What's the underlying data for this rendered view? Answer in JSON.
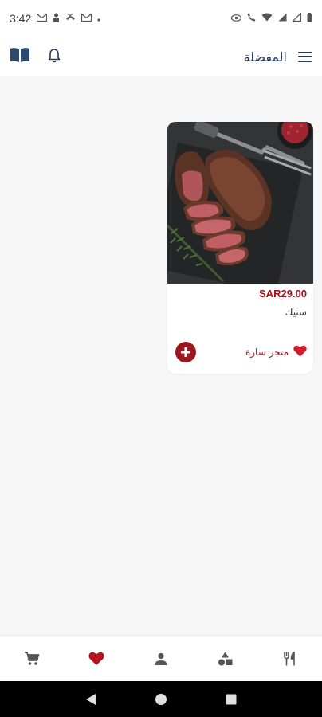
{
  "status_bar": {
    "time": "3:42",
    "icons_left": [
      "gmail-icon",
      "person-icon",
      "missed-call-icon",
      "gmail-icon",
      "dot-icon"
    ],
    "icons_right": [
      "eye-icon",
      "call-icon",
      "wifi-icon",
      "signal-icon",
      "signal-icon",
      "battery-icon"
    ]
  },
  "header": {
    "title": "المفضلة",
    "menu_icon": "hamburger-menu-icon",
    "book_icon": "book-icon",
    "bell_icon": "bell-icon"
  },
  "favorites": [
    {
      "price": "SAR29.00",
      "name": "ستيك",
      "store": "متجر سارة",
      "favorited": true
    }
  ],
  "bottom_nav": [
    {
      "icon": "cart-icon",
      "active": false
    },
    {
      "icon": "heart-icon",
      "active": true
    },
    {
      "icon": "profile-icon",
      "active": false
    },
    {
      "icon": "categories-icon",
      "active": false
    },
    {
      "icon": "restaurant-icon",
      "active": false
    }
  ],
  "colors": {
    "accent": "#a3111a",
    "title": "#1f3a5f",
    "nav_icon": "#555555"
  }
}
